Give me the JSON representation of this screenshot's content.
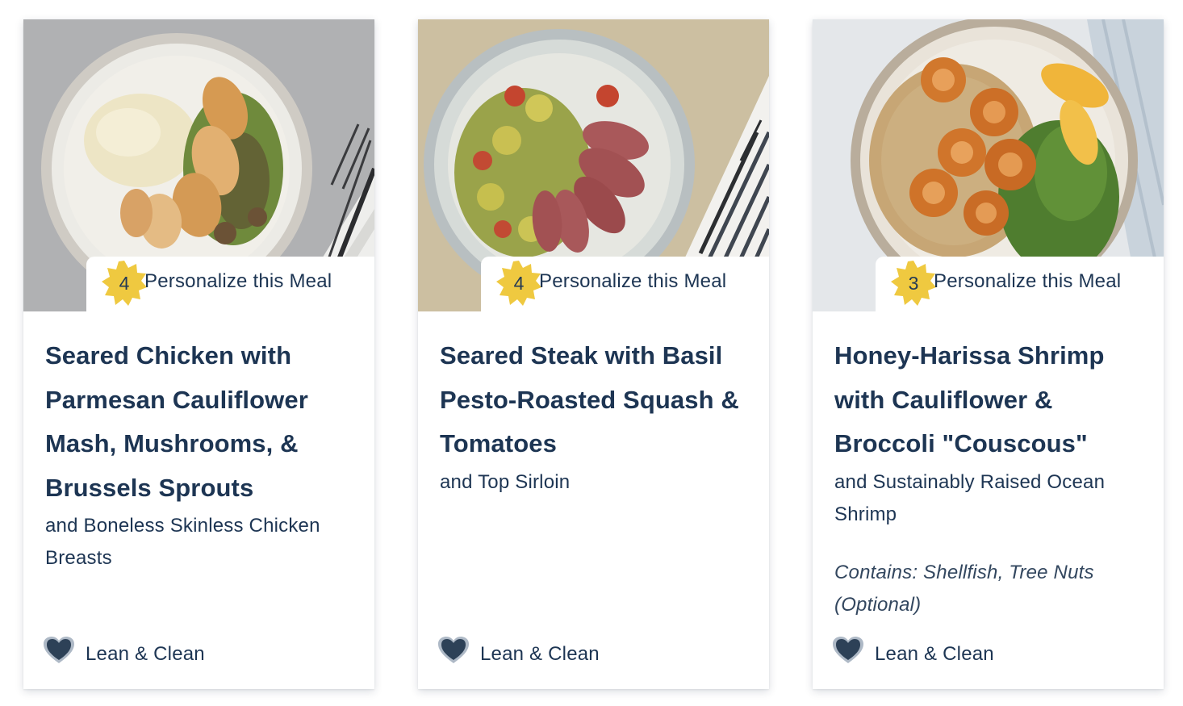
{
  "colors": {
    "text": "#1d3553",
    "badge": "#efc940",
    "heart": "#2d4157"
  },
  "meals": [
    {
      "personalize_count": "4",
      "personalize_label": "Personalize this Meal",
      "title": "Seared Chicken with Parmesan Cauliflower Mash, Mushrooms, & Brussels Sprouts",
      "subtitle": "and Boneless Skinless Chicken Breasts",
      "allergens": "",
      "tag_icon": "heart-icon",
      "tag_label": "Lean & Clean"
    },
    {
      "personalize_count": "4",
      "personalize_label": "Personalize this Meal",
      "title": "Seared Steak with Basil Pesto-Roasted Squash & Tomatoes",
      "subtitle": "and Top Sirloin",
      "allergens": "",
      "tag_icon": "heart-icon",
      "tag_label": "Lean & Clean"
    },
    {
      "personalize_count": "3",
      "personalize_label": "Personalize this Meal",
      "title": "Honey-Harissa Shrimp with Cauliflower & Broccoli \"Couscous\"",
      "subtitle": "and Sustainably Raised Ocean Shrimp",
      "allergens": "Contains: Shellfish, Tree Nuts (Optional)",
      "tag_icon": "heart-icon",
      "tag_label": "Lean & Clean"
    }
  ]
}
